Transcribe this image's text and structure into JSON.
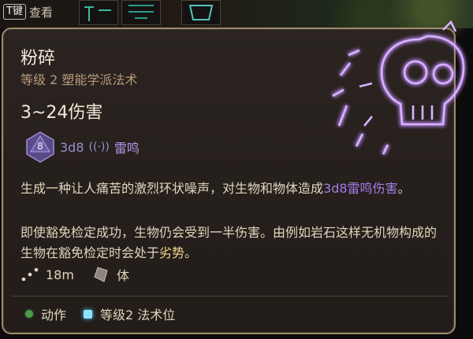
{
  "hint": {
    "key": "T键",
    "label": "查看"
  },
  "spell": {
    "name": "粉碎",
    "subtitle": "等级 2 塑能学派法术",
    "damage": "3~24伤害",
    "dice_face": "8",
    "dice": "3d8",
    "damage_icon": "thunder-icon",
    "damage_type": "雷鸣",
    "description_pre": "生成一种让人痛苦的激烈环状噪声，对生物和物体造成",
    "description_highlight": "3d8雷鸣伤害",
    "description_post": "。",
    "note_pre": "即使豁免检定成功，生物仍会受到一半伤害。由例如岩石这样无机物构成的生物在豁免检定时会处于",
    "note_highlight": "劣势",
    "note_post": "。",
    "range": "18m",
    "save": "体",
    "cost_action": "动作",
    "cost_slot": "等级2 法术位"
  },
  "colors": {
    "purple": "#a37be6",
    "yellow": "#f4d690",
    "action_green": "#4c9a4a",
    "slot_blue": "#8ee4ff"
  }
}
